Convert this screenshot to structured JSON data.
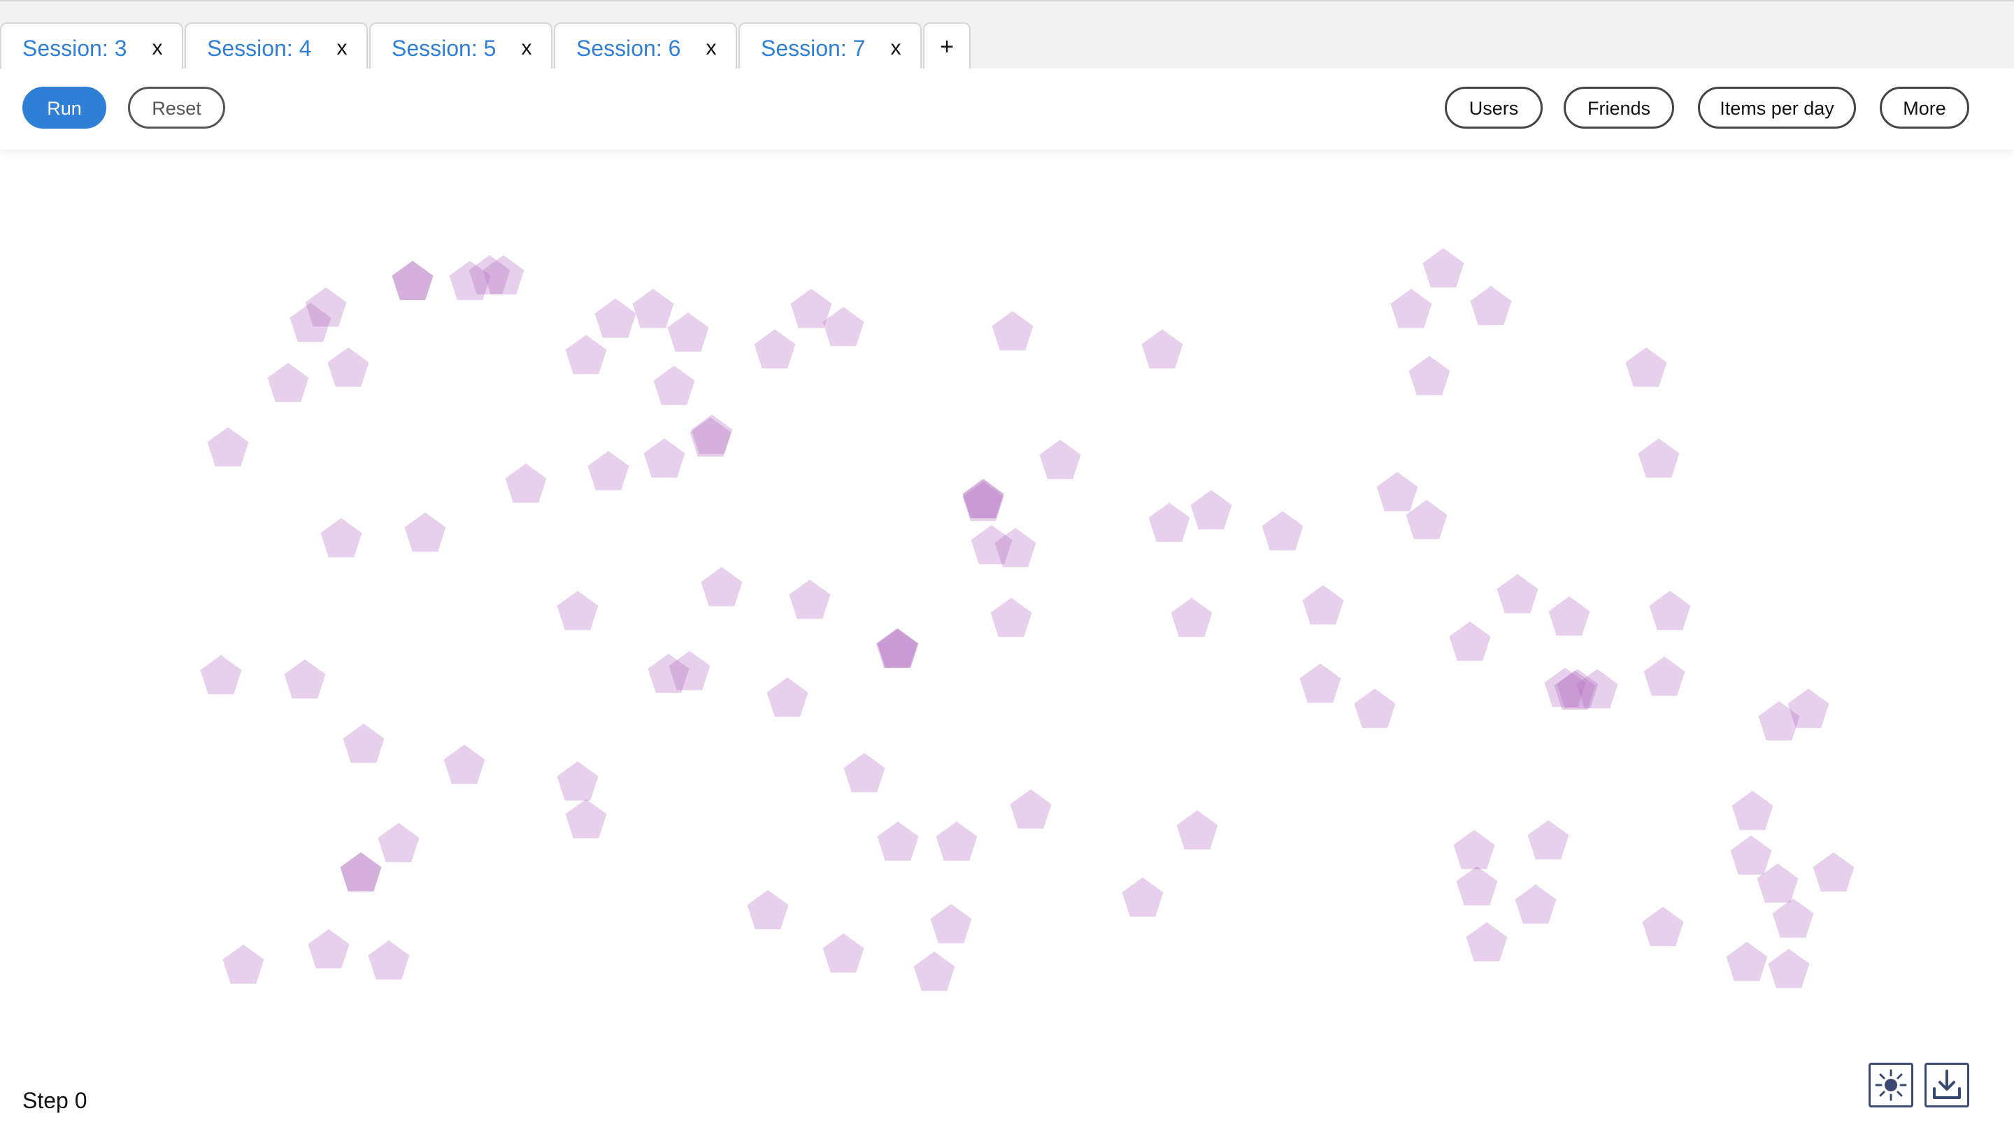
{
  "tabs": [
    {
      "label": "Session: 3",
      "close": "x"
    },
    {
      "label": "Session: 4",
      "close": "x"
    },
    {
      "label": "Session: 5",
      "close": "x"
    },
    {
      "label": "Session: 6",
      "close": "x"
    },
    {
      "label": "Session: 7",
      "close": "x"
    }
  ],
  "add_tab": "+",
  "toolbar": {
    "run": "Run",
    "reset": "Reset",
    "users": "Users",
    "friends": "Friends",
    "items_per_day": "Items per day",
    "more": "More"
  },
  "status": {
    "step": "Step 0"
  },
  "footer_icons": [
    "sun-icon",
    "download-icon"
  ],
  "colors": {
    "accent": "#2f7fd7",
    "agent_fill": "#b06ec0"
  }
}
